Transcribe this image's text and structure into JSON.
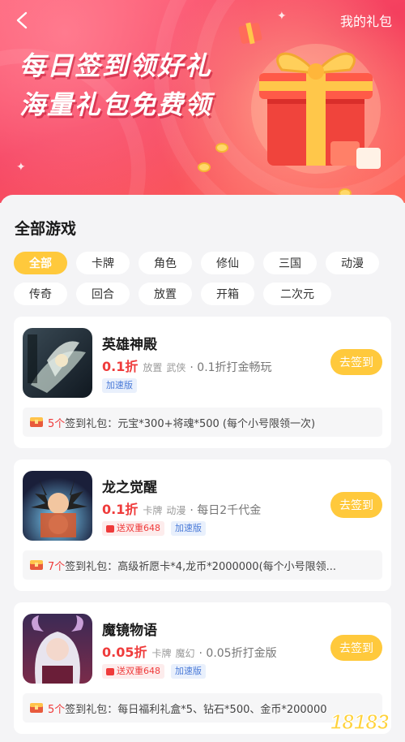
{
  "header": {
    "my_gifts": "我的礼包",
    "headline_line1": "每日签到领好礼",
    "headline_line2": "海量礼包免费领"
  },
  "section": {
    "title": "全部游戏"
  },
  "filters": [
    {
      "label": "全部",
      "active": true
    },
    {
      "label": "卡牌"
    },
    {
      "label": "角色"
    },
    {
      "label": "修仙"
    },
    {
      "label": "三国"
    },
    {
      "label": "动漫"
    },
    {
      "label": "传奇"
    },
    {
      "label": "回合"
    },
    {
      "label": "放置"
    },
    {
      "label": "开箱"
    },
    {
      "label": "二次元"
    }
  ],
  "games": [
    {
      "name": "英雄神殿",
      "discount": "0.1折",
      "tags": [
        "放置",
        "武侠"
      ],
      "desc": "· 0.1折打金畅玩",
      "badges": [
        {
          "type": "speed",
          "label": "加速版"
        }
      ],
      "signin_label": "去签到",
      "gift_count": "5个",
      "gift_text": "签到礼包：元宝*300+将魂*500 (每个小号限领一次)"
    },
    {
      "name": "龙之觉醒",
      "discount": "0.1折",
      "tags": [
        "卡牌",
        "动漫"
      ],
      "desc": "· 每日2千代金",
      "badges": [
        {
          "type": "gift",
          "label": "送双重648"
        },
        {
          "type": "speed",
          "label": "加速版"
        }
      ],
      "signin_label": "去签到",
      "gift_count": "7个",
      "gift_text": "签到礼包：高级祈愿卡*4,龙币*2000000(每个小号限领..."
    },
    {
      "name": "魔镜物语",
      "discount": "0.05折",
      "tags": [
        "卡牌",
        "魔幻"
      ],
      "desc": "· 0.05折打金版",
      "badges": [
        {
          "type": "gift",
          "label": "送双重648"
        },
        {
          "type": "speed",
          "label": "加速版"
        }
      ],
      "signin_label": "去签到",
      "gift_count": "5个",
      "gift_text": "签到礼包：每日福利礼盒*5、钻石*500、金币*200000"
    }
  ],
  "watermark": {
    "text": "18183"
  },
  "icons": [
    "back-arrow-icon",
    "gift-box-illustration",
    "chest-icon",
    "gift-mini-icon"
  ],
  "colors": {
    "accent_yellow": "#ffc93c",
    "discount_red": "#ef3b3b",
    "speed_blue": "#4b7bd8",
    "banner_red": "#f43f5e"
  }
}
